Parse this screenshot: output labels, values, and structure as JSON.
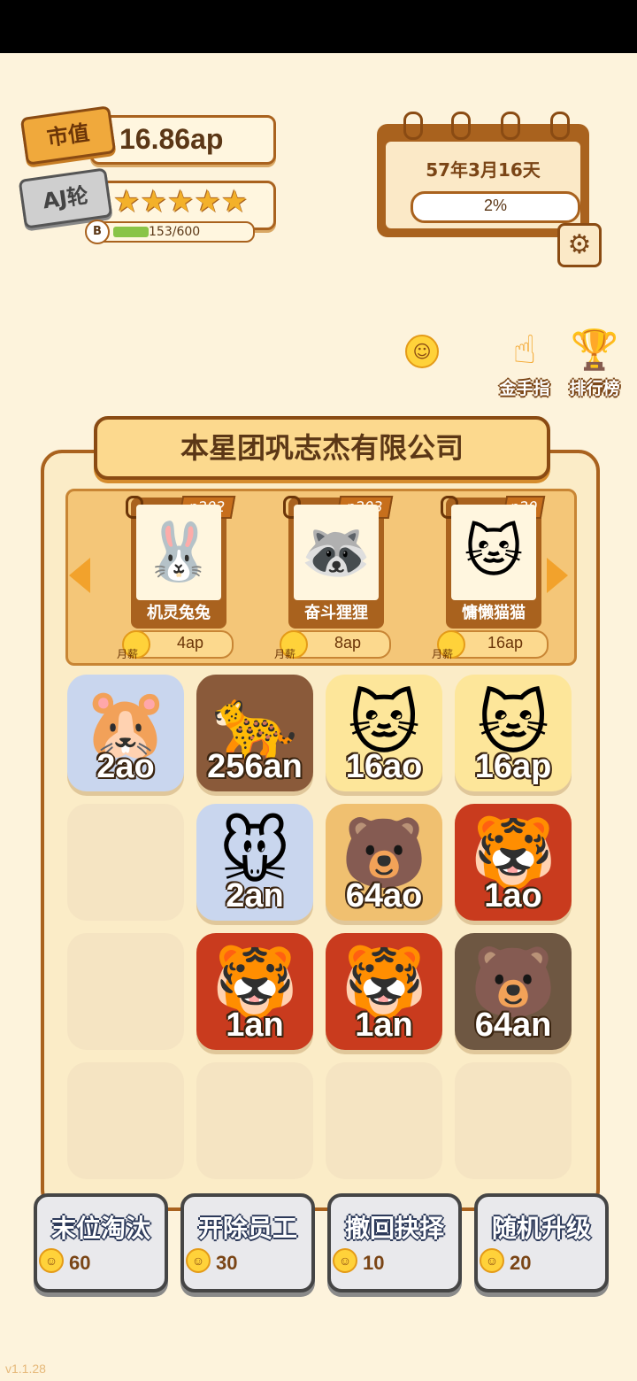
{
  "stats": {
    "market_label": "市值",
    "market_value": "16.86ap",
    "round_label": "AJ轮",
    "stars": "★★★★★",
    "level_badge": "B",
    "xp_text": "153/600"
  },
  "calendar": {
    "date": "57年3月16天",
    "mood_percent": "2%"
  },
  "tools": {
    "golden_finger": "金手指",
    "ranking": "排行榜"
  },
  "company": {
    "name": "本星团巩志杰有限公司"
  },
  "shop": {
    "cards": [
      {
        "code": "p202",
        "name": "机灵兔兔",
        "price": "4ap",
        "price_tag": "月薪",
        "emoji": "🐰"
      },
      {
        "code": "p203",
        "name": "奋斗狸狸",
        "price": "8ap",
        "price_tag": "月薪",
        "emoji": "🦝"
      },
      {
        "code": "p20",
        "name": "慵懒猫猫",
        "price": "16ap",
        "price_tag": "月薪",
        "emoji": "🐱"
      }
    ]
  },
  "grid": [
    [
      {
        "value": "2ao",
        "emoji": "🐹",
        "bg": "#c9d6ee"
      },
      {
        "value": "256an",
        "emoji": "🐆",
        "bg": "#8a5a3a"
      },
      {
        "value": "16ao",
        "emoji": "🐱",
        "bg": "#fde69a"
      },
      {
        "value": "16ap",
        "emoji": "🐱",
        "bg": "#fde69a"
      }
    ],
    [
      {
        "value": "",
        "emoji": "",
        "bg": ""
      },
      {
        "value": "2an",
        "emoji": "🐭",
        "bg": "#c9d6ee"
      },
      {
        "value": "64ao",
        "emoji": "🐻",
        "bg": "#f0c070"
      },
      {
        "value": "1ao",
        "emoji": "🐯",
        "bg": "#c93b1e"
      }
    ],
    [
      {
        "value": "",
        "emoji": "",
        "bg": ""
      },
      {
        "value": "1an",
        "emoji": "🐯",
        "bg": "#c93b1e"
      },
      {
        "value": "1an",
        "emoji": "🐯",
        "bg": "#c93b1e"
      },
      {
        "value": "64an",
        "emoji": "🐻",
        "bg": "#6e5742"
      }
    ],
    [
      {
        "value": "",
        "emoji": "",
        "bg": ""
      },
      {
        "value": "",
        "emoji": "",
        "bg": ""
      },
      {
        "value": "",
        "emoji": "",
        "bg": ""
      },
      {
        "value": "",
        "emoji": "",
        "bg": ""
      }
    ]
  ],
  "actions": [
    {
      "label": "末位淘汰",
      "cost": "60"
    },
    {
      "label": "开除员工",
      "cost": "30"
    },
    {
      "label": "撤回抉择",
      "cost": "10"
    },
    {
      "label": "随机升级",
      "cost": "20"
    }
  ],
  "version": "v1.1.28",
  "icons": {
    "smiley": "smiley-icon",
    "gear": "gear-icon",
    "hand": "pointing-hand-icon",
    "trophy": "trophy-icon",
    "coin": "coin-icon"
  }
}
